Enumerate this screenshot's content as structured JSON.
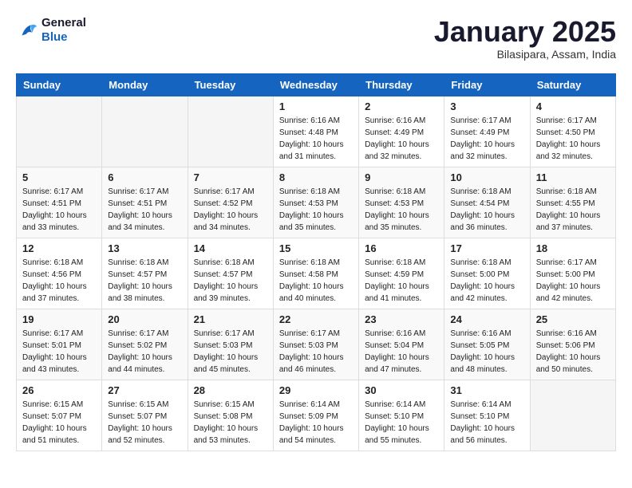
{
  "header": {
    "logo_line1": "General",
    "logo_line2": "Blue",
    "month_title": "January 2025",
    "location": "Bilasipara, Assam, India"
  },
  "weekdays": [
    "Sunday",
    "Monday",
    "Tuesday",
    "Wednesday",
    "Thursday",
    "Friday",
    "Saturday"
  ],
  "weeks": [
    [
      {
        "day": "",
        "sunrise": "",
        "sunset": "",
        "daylight": ""
      },
      {
        "day": "",
        "sunrise": "",
        "sunset": "",
        "daylight": ""
      },
      {
        "day": "",
        "sunrise": "",
        "sunset": "",
        "daylight": ""
      },
      {
        "day": "1",
        "sunrise": "Sunrise: 6:16 AM",
        "sunset": "Sunset: 4:48 PM",
        "daylight": "Daylight: 10 hours and 31 minutes."
      },
      {
        "day": "2",
        "sunrise": "Sunrise: 6:16 AM",
        "sunset": "Sunset: 4:49 PM",
        "daylight": "Daylight: 10 hours and 32 minutes."
      },
      {
        "day": "3",
        "sunrise": "Sunrise: 6:17 AM",
        "sunset": "Sunset: 4:49 PM",
        "daylight": "Daylight: 10 hours and 32 minutes."
      },
      {
        "day": "4",
        "sunrise": "Sunrise: 6:17 AM",
        "sunset": "Sunset: 4:50 PM",
        "daylight": "Daylight: 10 hours and 32 minutes."
      }
    ],
    [
      {
        "day": "5",
        "sunrise": "Sunrise: 6:17 AM",
        "sunset": "Sunset: 4:51 PM",
        "daylight": "Daylight: 10 hours and 33 minutes."
      },
      {
        "day": "6",
        "sunrise": "Sunrise: 6:17 AM",
        "sunset": "Sunset: 4:51 PM",
        "daylight": "Daylight: 10 hours and 34 minutes."
      },
      {
        "day": "7",
        "sunrise": "Sunrise: 6:17 AM",
        "sunset": "Sunset: 4:52 PM",
        "daylight": "Daylight: 10 hours and 34 minutes."
      },
      {
        "day": "8",
        "sunrise": "Sunrise: 6:18 AM",
        "sunset": "Sunset: 4:53 PM",
        "daylight": "Daylight: 10 hours and 35 minutes."
      },
      {
        "day": "9",
        "sunrise": "Sunrise: 6:18 AM",
        "sunset": "Sunset: 4:53 PM",
        "daylight": "Daylight: 10 hours and 35 minutes."
      },
      {
        "day": "10",
        "sunrise": "Sunrise: 6:18 AM",
        "sunset": "Sunset: 4:54 PM",
        "daylight": "Daylight: 10 hours and 36 minutes."
      },
      {
        "day": "11",
        "sunrise": "Sunrise: 6:18 AM",
        "sunset": "Sunset: 4:55 PM",
        "daylight": "Daylight: 10 hours and 37 minutes."
      }
    ],
    [
      {
        "day": "12",
        "sunrise": "Sunrise: 6:18 AM",
        "sunset": "Sunset: 4:56 PM",
        "daylight": "Daylight: 10 hours and 37 minutes."
      },
      {
        "day": "13",
        "sunrise": "Sunrise: 6:18 AM",
        "sunset": "Sunset: 4:57 PM",
        "daylight": "Daylight: 10 hours and 38 minutes."
      },
      {
        "day": "14",
        "sunrise": "Sunrise: 6:18 AM",
        "sunset": "Sunset: 4:57 PM",
        "daylight": "Daylight: 10 hours and 39 minutes."
      },
      {
        "day": "15",
        "sunrise": "Sunrise: 6:18 AM",
        "sunset": "Sunset: 4:58 PM",
        "daylight": "Daylight: 10 hours and 40 minutes."
      },
      {
        "day": "16",
        "sunrise": "Sunrise: 6:18 AM",
        "sunset": "Sunset: 4:59 PM",
        "daylight": "Daylight: 10 hours and 41 minutes."
      },
      {
        "day": "17",
        "sunrise": "Sunrise: 6:18 AM",
        "sunset": "Sunset: 5:00 PM",
        "daylight": "Daylight: 10 hours and 42 minutes."
      },
      {
        "day": "18",
        "sunrise": "Sunrise: 6:17 AM",
        "sunset": "Sunset: 5:00 PM",
        "daylight": "Daylight: 10 hours and 42 minutes."
      }
    ],
    [
      {
        "day": "19",
        "sunrise": "Sunrise: 6:17 AM",
        "sunset": "Sunset: 5:01 PM",
        "daylight": "Daylight: 10 hours and 43 minutes."
      },
      {
        "day": "20",
        "sunrise": "Sunrise: 6:17 AM",
        "sunset": "Sunset: 5:02 PM",
        "daylight": "Daylight: 10 hours and 44 minutes."
      },
      {
        "day": "21",
        "sunrise": "Sunrise: 6:17 AM",
        "sunset": "Sunset: 5:03 PM",
        "daylight": "Daylight: 10 hours and 45 minutes."
      },
      {
        "day": "22",
        "sunrise": "Sunrise: 6:17 AM",
        "sunset": "Sunset: 5:03 PM",
        "daylight": "Daylight: 10 hours and 46 minutes."
      },
      {
        "day": "23",
        "sunrise": "Sunrise: 6:16 AM",
        "sunset": "Sunset: 5:04 PM",
        "daylight": "Daylight: 10 hours and 47 minutes."
      },
      {
        "day": "24",
        "sunrise": "Sunrise: 6:16 AM",
        "sunset": "Sunset: 5:05 PM",
        "daylight": "Daylight: 10 hours and 48 minutes."
      },
      {
        "day": "25",
        "sunrise": "Sunrise: 6:16 AM",
        "sunset": "Sunset: 5:06 PM",
        "daylight": "Daylight: 10 hours and 50 minutes."
      }
    ],
    [
      {
        "day": "26",
        "sunrise": "Sunrise: 6:15 AM",
        "sunset": "Sunset: 5:07 PM",
        "daylight": "Daylight: 10 hours and 51 minutes."
      },
      {
        "day": "27",
        "sunrise": "Sunrise: 6:15 AM",
        "sunset": "Sunset: 5:07 PM",
        "daylight": "Daylight: 10 hours and 52 minutes."
      },
      {
        "day": "28",
        "sunrise": "Sunrise: 6:15 AM",
        "sunset": "Sunset: 5:08 PM",
        "daylight": "Daylight: 10 hours and 53 minutes."
      },
      {
        "day": "29",
        "sunrise": "Sunrise: 6:14 AM",
        "sunset": "Sunset: 5:09 PM",
        "daylight": "Daylight: 10 hours and 54 minutes."
      },
      {
        "day": "30",
        "sunrise": "Sunrise: 6:14 AM",
        "sunset": "Sunset: 5:10 PM",
        "daylight": "Daylight: 10 hours and 55 minutes."
      },
      {
        "day": "31",
        "sunrise": "Sunrise: 6:14 AM",
        "sunset": "Sunset: 5:10 PM",
        "daylight": "Daylight: 10 hours and 56 minutes."
      },
      {
        "day": "",
        "sunrise": "",
        "sunset": "",
        "daylight": ""
      }
    ]
  ]
}
